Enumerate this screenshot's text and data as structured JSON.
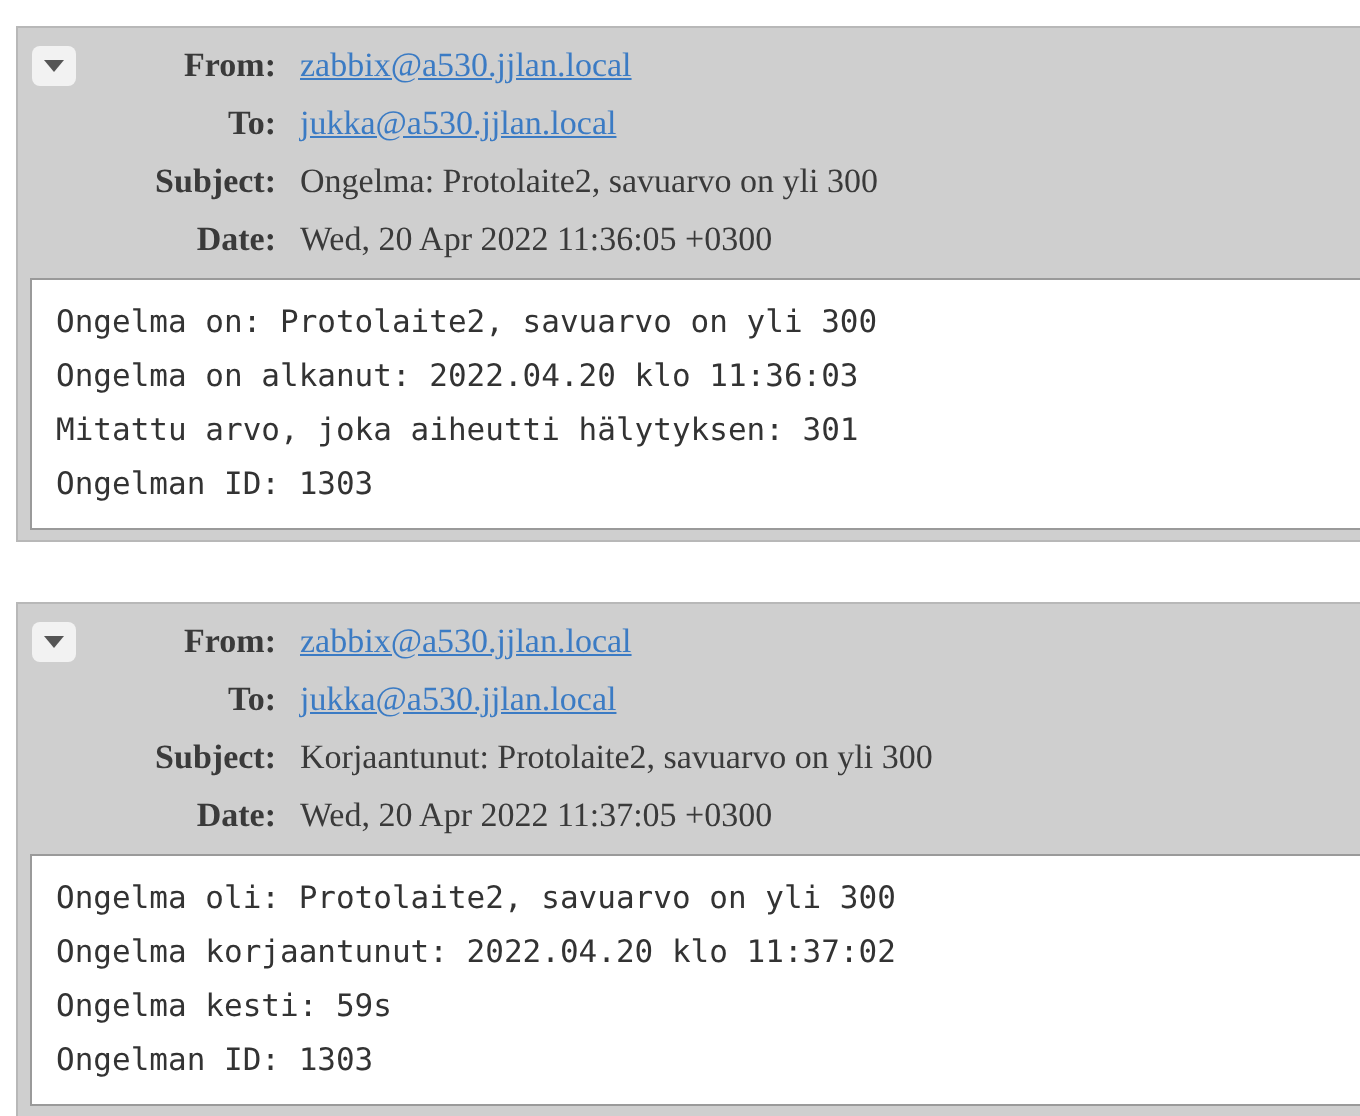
{
  "messages": [
    {
      "expanded": true,
      "headers": [
        {
          "label": "From:",
          "value": "zabbix@a530.jjlan.local",
          "kind": "link"
        },
        {
          "label": "To:",
          "value": "jukka@a530.jjlan.local",
          "kind": "link"
        },
        {
          "label": "Subject:",
          "value": "Ongelma: Protolaite2, savuarvo on yli 300",
          "kind": "text"
        },
        {
          "label": "Date:",
          "value": "Wed, 20 Apr 2022 11:36:05 +0300",
          "kind": "text"
        }
      ],
      "body": [
        "Ongelma on: Protolaite2, savuarvo on yli 300",
        "Ongelma on alkanut: 2022.04.20 klo 11:36:03",
        "Mitattu arvo, joka aiheutti hälytyksen: 301",
        "Ongelman ID: 1303"
      ]
    },
    {
      "expanded": true,
      "headers": [
        {
          "label": "From:",
          "value": "zabbix@a530.jjlan.local",
          "kind": "link"
        },
        {
          "label": "To:",
          "value": "jukka@a530.jjlan.local",
          "kind": "link"
        },
        {
          "label": "Subject:",
          "value": "Korjaantunut: Protolaite2, savuarvo on yli 300",
          "kind": "text"
        },
        {
          "label": "Date:",
          "value": "Wed, 20 Apr 2022 11:37:05 +0300",
          "kind": "text"
        }
      ],
      "body": [
        "Ongelma oli: Protolaite2, savuarvo on yli 300",
        "Ongelma korjaantunut: 2022.04.20 klo 11:37:02",
        "Ongelma kesti: 59s",
        "Ongelman ID: 1303"
      ]
    }
  ]
}
